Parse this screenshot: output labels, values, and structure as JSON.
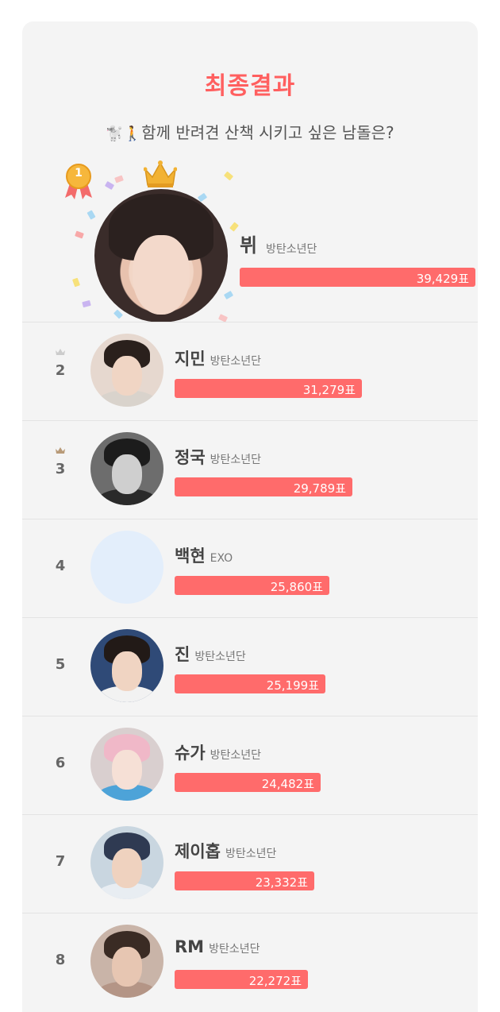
{
  "header": {
    "title": "최종결과",
    "question_emoji": "🐩🚶",
    "question": "함께 반려견 산책 시키고 싶은 남돌은?"
  },
  "colors": {
    "accent": "#ff5f5f",
    "bar": "#ff6b6b",
    "card_bg": "#f4f4f4",
    "text": "#444444",
    "muted": "#777777"
  },
  "winner": {
    "rank": "1",
    "name": "뷔",
    "group": "방탄소년단",
    "votes": "39,429표",
    "share": 1.0
  },
  "rankings": [
    {
      "rank": "2",
      "name": "지민",
      "group": "방탄소년단",
      "votes": "31,279표",
      "share": 0.793,
      "crown": true,
      "avatar": {
        "bg": "#e6d8cf",
        "hair": "#2a201c",
        "skin": "#f0d5c4",
        "shirt": "#d9d3cc"
      }
    },
    {
      "rank": "3",
      "name": "정국",
      "group": "방탄소년단",
      "votes": "29,789표",
      "share": 0.755,
      "crown": true,
      "avatar": {
        "bg": "#6d6d6d",
        "hair": "#1c1c1c",
        "skin": "#cfcfcf",
        "shirt": "#2a2a2a"
      }
    },
    {
      "rank": "4",
      "name": "백현",
      "group": "EXO",
      "votes": "25,860표",
      "share": 0.656,
      "crown": false,
      "avatar": {
        "bg": "#e3eefb",
        "hair": "#e3eefb",
        "skin": "#e3eefb",
        "shirt": "#e3eefb"
      }
    },
    {
      "rank": "5",
      "name": "진",
      "group": "방탄소년단",
      "votes": "25,199표",
      "share": 0.639,
      "crown": false,
      "avatar": {
        "bg": "#2f4a77",
        "hair": "#221a17",
        "skin": "#f0d4c2",
        "shirt": "#f2f2f2"
      }
    },
    {
      "rank": "6",
      "name": "슈가",
      "group": "방탄소년단",
      "votes": "24,482표",
      "share": 0.621,
      "crown": false,
      "avatar": {
        "bg": "#d9cfcf",
        "hair": "#f0b8c8",
        "skin": "#f6e0d6",
        "shirt": "#4da3d8"
      }
    },
    {
      "rank": "7",
      "name": "제이홉",
      "group": "방탄소년단",
      "votes": "23,332표",
      "share": 0.592,
      "crown": false,
      "avatar": {
        "bg": "#c9d6e0",
        "hair": "#2f3a52",
        "skin": "#efd2bf",
        "shirt": "#e8edf2"
      }
    },
    {
      "rank": "8",
      "name": "RM",
      "group": "방탄소년단",
      "votes": "22,272표",
      "share": 0.565,
      "crown": false,
      "avatar": {
        "bg": "#c9b4a8",
        "hair": "#3a2b24",
        "skin": "#e7c6b2",
        "shirt": "#b49586"
      }
    }
  ]
}
